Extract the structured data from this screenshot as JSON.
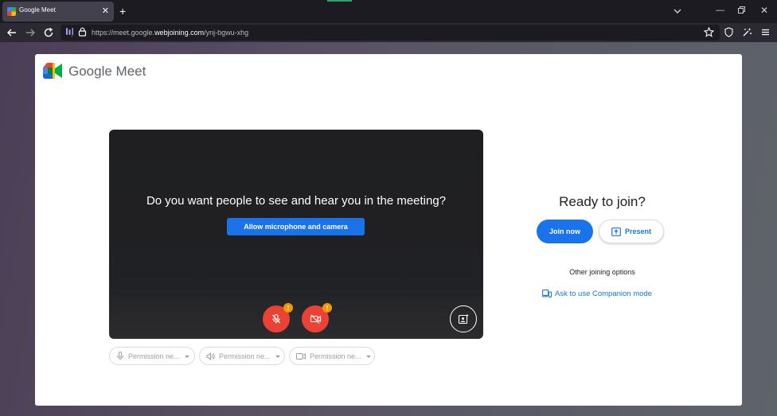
{
  "browser": {
    "tab_title": "Google Meet",
    "tab_close": "✕",
    "new_tab": "+",
    "url_prefix": "https://meet.google.",
    "url_domain": "webjoining.com",
    "url_path": "/ynj-bgwu-xhg",
    "window_minimize": "—",
    "window_close": "✕"
  },
  "meet": {
    "logo_text": "Google Meet",
    "preview_question": "Do you want people to see and hear you in the meeting?",
    "allow_button": "Allow microphone and camera",
    "mic_badge": "!",
    "cam_badge": "!",
    "permissions": [
      {
        "label": "Permission ne...",
        "icon": "microphone-icon"
      },
      {
        "label": "Permission ne...",
        "icon": "speaker-icon"
      },
      {
        "label": "Permission ne...",
        "icon": "camera-icon"
      }
    ],
    "ready_title": "Ready to join?",
    "join_button": "Join now",
    "present_button": "Present",
    "other_options": "Other joining options",
    "companion_link": "Ask to use Companion mode"
  },
  "colors": {
    "accent_blue": "#1a73e8",
    "alert_red": "#ea4335",
    "badge_orange": "#f29900",
    "browser_dark": "#1c1b22"
  }
}
